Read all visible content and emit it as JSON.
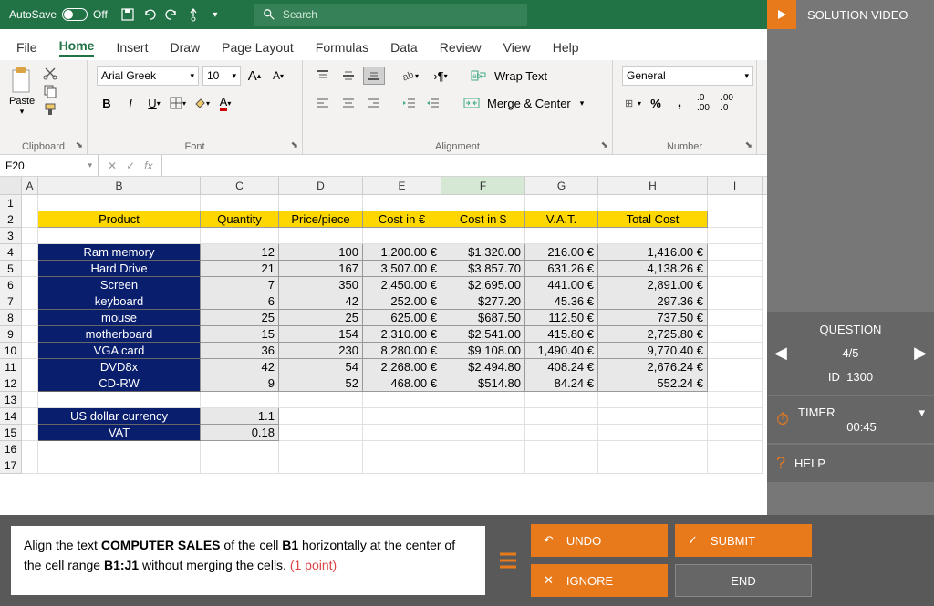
{
  "title_bar": {
    "autosave": "AutoSave",
    "autosave_state": "Off",
    "search_placeholder": "Search"
  },
  "tabs": [
    "File",
    "Home",
    "Insert",
    "Draw",
    "Page Layout",
    "Formulas",
    "Data",
    "Review",
    "View",
    "Help"
  ],
  "active_tab": "Home",
  "ribbon": {
    "clipboard": {
      "paste": "Paste",
      "label": "Clipboard"
    },
    "font": {
      "name": "Arial Greek",
      "size": "10",
      "label": "Font"
    },
    "alignment": {
      "wrap": "Wrap Text",
      "merge": "Merge & Center",
      "label": "Alignment"
    },
    "number": {
      "format": "General",
      "label": "Number"
    }
  },
  "name_box": "F20",
  "columns": [
    "A",
    "B",
    "C",
    "D",
    "E",
    "F",
    "G",
    "H",
    "I"
  ],
  "selected_col": "F",
  "headers": [
    "Product",
    "Quantity",
    "Price/piece",
    "Cost in €",
    "Cost in $",
    "V.A.T.",
    "Total Cost"
  ],
  "rows": [
    {
      "p": "Ram memory",
      "q": "12",
      "pp": "100",
      "ce": "1,200.00 €",
      "cd": "$1,320.00",
      "v": "216.00 €",
      "t": "1,416.00 €"
    },
    {
      "p": "Hard Drive",
      "q": "21",
      "pp": "167",
      "ce": "3,507.00 €",
      "cd": "$3,857.70",
      "v": "631.26 €",
      "t": "4,138.26 €"
    },
    {
      "p": "Screen",
      "q": "7",
      "pp": "350",
      "ce": "2,450.00 €",
      "cd": "$2,695.00",
      "v": "441.00 €",
      "t": "2,891.00 €"
    },
    {
      "p": "keyboard",
      "q": "6",
      "pp": "42",
      "ce": "252.00 €",
      "cd": "$277.20",
      "v": "45.36 €",
      "t": "297.36 €"
    },
    {
      "p": "mouse",
      "q": "25",
      "pp": "25",
      "ce": "625.00 €",
      "cd": "$687.50",
      "v": "112.50 €",
      "t": "737.50 €"
    },
    {
      "p": "motherboard",
      "q": "15",
      "pp": "154",
      "ce": "2,310.00 €",
      "cd": "$2,541.00",
      "v": "415.80 €",
      "t": "2,725.80 €"
    },
    {
      "p": "VGA card",
      "q": "36",
      "pp": "230",
      "ce": "8,280.00 €",
      "cd": "$9,108.00",
      "v": "1,490.40 €",
      "t": "9,770.40 €"
    },
    {
      "p": "DVD8x",
      "q": "42",
      "pp": "54",
      "ce": "2,268.00 €",
      "cd": "$2,494.80",
      "v": "408.24 €",
      "t": "2,676.24 €"
    },
    {
      "p": "CD-RW",
      "q": "9",
      "pp": "52",
      "ce": "468.00 €",
      "cd": "$514.80",
      "v": "84.24 €",
      "t": "552.24 €"
    }
  ],
  "extras": [
    {
      "label": "US dollar currency",
      "val": "1.1"
    },
    {
      "label": "VAT",
      "val": "0.18"
    }
  ],
  "side": {
    "solution": "SOLUTION VIDEO",
    "question": "QUESTION",
    "progress": "4/5",
    "id_label": "ID",
    "id": "1300",
    "timer_label": "TIMER",
    "timer": "00:45",
    "help": "HELP"
  },
  "instruction": {
    "pre": "Align the text ",
    "b1": "COMPUTER SALES",
    "mid1": " of the cell ",
    "b2": "B1",
    "mid2": " horizontally at the center of the cell range ",
    "b3": "B1:J1",
    "mid3": " without merging the cells. ",
    "points": "(1 point)"
  },
  "actions": {
    "undo": "UNDO",
    "ignore": "IGNORE",
    "submit": "SUBMIT",
    "end": "END"
  }
}
